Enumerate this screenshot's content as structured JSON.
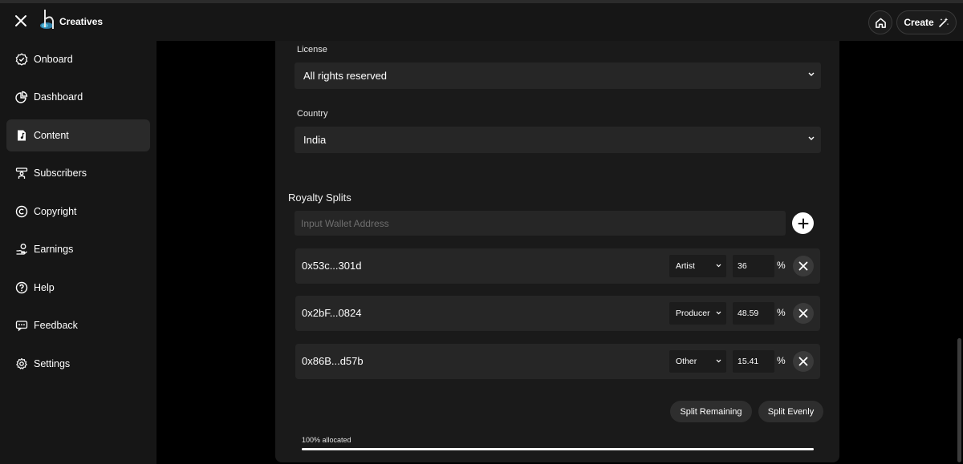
{
  "header": {
    "brand": "Creatives",
    "create_label": "Create"
  },
  "sidebar": {
    "items": [
      {
        "label": "Onboard",
        "icon": "badge-check-icon"
      },
      {
        "label": "Dashboard",
        "icon": "pie-chart-icon"
      },
      {
        "label": "Content",
        "icon": "music-file-icon",
        "active": true
      },
      {
        "label": "Subscribers",
        "icon": "people-icon"
      },
      {
        "label": "Copyright",
        "icon": "copyright-icon"
      },
      {
        "label": "Earnings",
        "icon": "hand-coin-icon"
      },
      {
        "label": "Help",
        "icon": "help-icon"
      },
      {
        "label": "Feedback",
        "icon": "feedback-icon"
      },
      {
        "label": "Settings",
        "icon": "gear-icon"
      }
    ]
  },
  "form": {
    "license_label": "License",
    "license_value": "All rights reserved",
    "country_label": "Country",
    "country_value": "India"
  },
  "royalty": {
    "title": "Royalty Splits",
    "wallet_placeholder": "Input Wallet Address",
    "splits": [
      {
        "address": "0x53c...301d",
        "role": "Artist",
        "percent": "36"
      },
      {
        "address": "0x2bF...0824",
        "role": "Producer",
        "percent": "48.59"
      },
      {
        "address": "0x86B...d57b",
        "role": "Other",
        "percent": "15.41"
      }
    ],
    "percent_sign": "%",
    "split_remaining_label": "Split Remaining",
    "split_evenly_label": "Split Evenly",
    "allocated_label": "100% allocated",
    "allocated_fraction": 1.0
  },
  "colors": {
    "background": "#000000",
    "sidebar": "#161616",
    "panel": "#1a1a1a",
    "field": "#262626",
    "active_nav": "#2a2a2a"
  }
}
